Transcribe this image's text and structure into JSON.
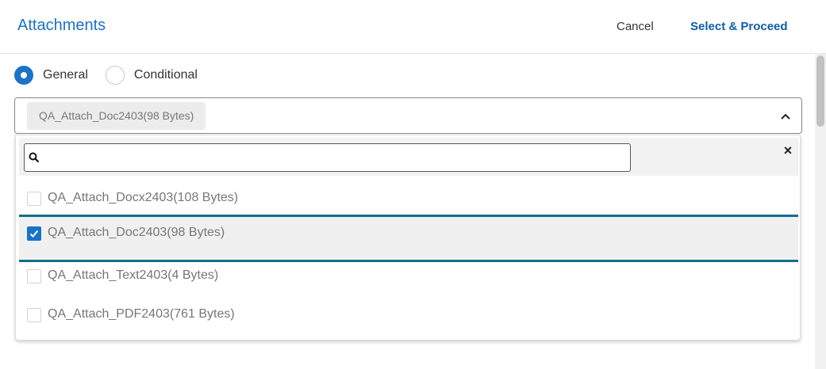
{
  "header": {
    "title": "Attachments",
    "cancel_label": "Cancel",
    "proceed_label": "Select & Proceed"
  },
  "type_selector": {
    "options": [
      {
        "label": "General",
        "checked": true
      },
      {
        "label": "Conditional",
        "checked": false
      }
    ]
  },
  "attachment_select": {
    "selected_chip": "QA_Attach_Doc2403(98 Bytes)",
    "search": {
      "value": "",
      "placeholder": ""
    },
    "options": [
      {
        "label": "QA_Attach_Docx2403(108 Bytes)",
        "checked": false
      },
      {
        "label": "QA_Attach_Doc2403(98 Bytes)",
        "checked": true
      },
      {
        "label": "QA_Attach_Text2403(4 Bytes)",
        "checked": false
      },
      {
        "label": "QA_Attach_PDF2403(761 Bytes)",
        "checked": false
      }
    ]
  },
  "colors": {
    "accent": "#1a73c7",
    "selected_border": "#0e6f8c"
  }
}
